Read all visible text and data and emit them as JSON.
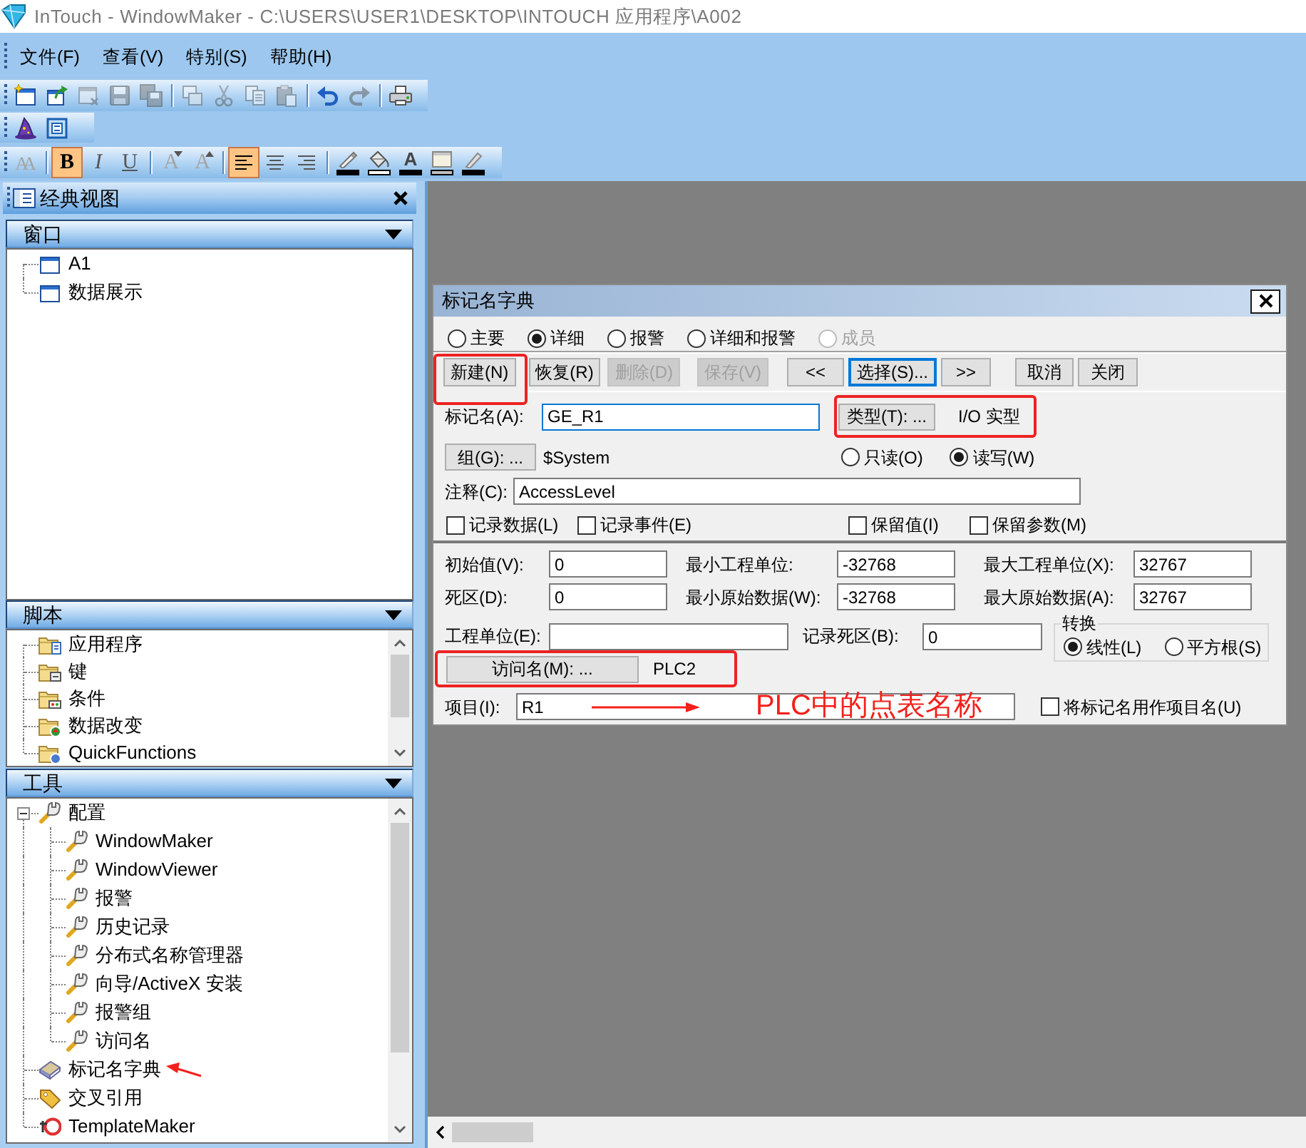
{
  "window": {
    "title": "InTouch - WindowMaker - C:\\USERS\\USER1\\DESKTOP\\INTOUCH 应用程序\\A002"
  },
  "menu": [
    {
      "label": "文件(F)"
    },
    {
      "label": "查看(V)"
    },
    {
      "label": "特别(S)"
    },
    {
      "label": "帮助(H)"
    }
  ],
  "toolbars": [
    [
      {
        "kind": "new",
        "disabled": false
      },
      {
        "kind": "open",
        "disabled": false
      },
      {
        "kind": "close",
        "disabled": true
      },
      {
        "kind": "save",
        "disabled": true
      },
      {
        "kind": "saveall",
        "disabled": true
      },
      {
        "kind": "separator"
      },
      {
        "kind": "duplicate",
        "disabled": true
      },
      {
        "kind": "cut",
        "disabled": true
      },
      {
        "kind": "copy",
        "disabled": true
      },
      {
        "kind": "paste",
        "disabled": true
      },
      {
        "kind": "separator"
      },
      {
        "kind": "undo",
        "disabled": false
      },
      {
        "kind": "redo",
        "disabled": true
      },
      {
        "kind": "separator"
      },
      {
        "kind": "print",
        "disabled": false
      }
    ],
    [
      {
        "kind": "wizard",
        "disabled": false
      },
      {
        "kind": "script",
        "disabled": false
      }
    ],
    [
      {
        "kind": "font",
        "glyph": "AA",
        "disabled": true
      },
      {
        "kind": "separator"
      },
      {
        "kind": "bold",
        "glyph": "B",
        "disabled": false,
        "selected": true
      },
      {
        "kind": "italic",
        "glyph": "I",
        "disabled": false,
        "selected": false
      },
      {
        "kind": "underline",
        "glyph": "U",
        "disabled": false,
        "selected": false
      },
      {
        "kind": "separator"
      },
      {
        "kind": "shrink",
        "glyph": "A",
        "disabled": true
      },
      {
        "kind": "enlarge",
        "glyph": "A",
        "disabled": true
      },
      {
        "kind": "separator"
      },
      {
        "kind": "alignleft",
        "disabled": false,
        "selected": true
      },
      {
        "kind": "aligncenter",
        "disabled": false,
        "selected": false
      },
      {
        "kind": "alignright",
        "disabled": false,
        "selected": false
      },
      {
        "kind": "separator"
      },
      {
        "kind": "linecolor",
        "disabled": false,
        "color": "#000000"
      },
      {
        "kind": "fillcolor",
        "disabled": false,
        "color": "#ffffff"
      },
      {
        "kind": "textcolor",
        "glyph": "A",
        "disabled": false,
        "color": "#000000"
      },
      {
        "kind": "windowcolor",
        "disabled": false,
        "color": "#c0c0c0"
      },
      {
        "kind": "pen",
        "disabled": false,
        "color": "#000000"
      }
    ]
  ],
  "panel": {
    "title": "经典视图",
    "sections": [
      {
        "title": "窗口",
        "scrollable": false,
        "items": [
          {
            "label": "A1",
            "kind": "window"
          },
          {
            "label": "数据展示",
            "kind": "window"
          }
        ]
      },
      {
        "title": "脚本",
        "scrollable": true,
        "items": [
          {
            "label": "应用程序",
            "kind": "app-script"
          },
          {
            "label": "键",
            "kind": "key-script"
          },
          {
            "label": "条件",
            "kind": "condition-script"
          },
          {
            "label": "数据改变",
            "kind": "data-script"
          },
          {
            "label": "QuickFunctions",
            "kind": "quick-script"
          }
        ]
      },
      {
        "title": "工具",
        "scrollable": true,
        "items": [
          {
            "label": "配置",
            "kind": "tool",
            "expanded": true,
            "marked": false,
            "children": [
              {
                "label": "WindowMaker",
                "kind": "tool"
              },
              {
                "label": "WindowViewer",
                "kind": "tool"
              },
              {
                "label": "报警",
                "kind": "tool"
              },
              {
                "label": "历史记录",
                "kind": "tool"
              },
              {
                "label": "分布式名称管理器",
                "kind": "tool"
              },
              {
                "label": "向导/ActiveX 安装",
                "kind": "tool"
              },
              {
                "label": "报警组",
                "kind": "tool"
              },
              {
                "label": "访问名",
                "kind": "tool"
              }
            ]
          },
          {
            "label": "标记名字典",
            "kind": "dictionary",
            "marked": true
          },
          {
            "label": "交叉引用",
            "kind": "crossref",
            "marked": false
          },
          {
            "label": "TemplateMaker",
            "kind": "template",
            "marked": false
          }
        ]
      }
    ]
  },
  "dialog": {
    "title": "标记名字典",
    "view_options": [
      {
        "label": "主要",
        "selected": false,
        "disabled": false
      },
      {
        "label": "详细",
        "selected": true,
        "disabled": false
      },
      {
        "label": "报警",
        "selected": false,
        "disabled": false
      },
      {
        "label": "详细和报警",
        "selected": false,
        "disabled": false
      },
      {
        "label": "成员",
        "selected": false,
        "disabled": true
      }
    ],
    "buttons": [
      {
        "label": "新建(N)",
        "disabled": false,
        "focused": false,
        "highlighted": true
      },
      {
        "label": "恢复(R)",
        "disabled": false,
        "focused": false,
        "highlighted": false
      },
      {
        "label": "删除(D)",
        "disabled": true,
        "focused": false,
        "highlighted": false
      },
      {
        "label": "保存(V)",
        "disabled": true,
        "focused": false,
        "highlighted": false
      },
      {
        "label": "<<",
        "disabled": false,
        "focused": false,
        "highlighted": false
      },
      {
        "label": "选择(S)...",
        "disabled": false,
        "focused": true,
        "highlighted": false
      },
      {
        "label": ">>",
        "disabled": false,
        "focused": false,
        "highlighted": false
      },
      {
        "label": "取消",
        "disabled": false,
        "focused": false,
        "highlighted": false
      },
      {
        "label": "关闭",
        "disabled": false,
        "focused": false,
        "highlighted": false
      }
    ],
    "tagname": {
      "label": "标记名(A):",
      "value": "GE_R1",
      "focused": true
    },
    "type": {
      "button": "类型(T): ...",
      "value": "I/O 实型",
      "highlighted": true
    },
    "group": {
      "button": "组(G): ...",
      "value": "$System"
    },
    "access_modes": [
      {
        "label": "只读(O)",
        "selected": false
      },
      {
        "label": "读写(W)",
        "selected": true
      }
    ],
    "comment": {
      "label": "注释(C):",
      "value": "AccessLevel"
    },
    "options": [
      {
        "label": "记录数据(L)",
        "checked": false
      },
      {
        "label": "记录事件(E)",
        "checked": false
      },
      {
        "label": "保留值(I)",
        "checked": false
      },
      {
        "label": "保留参数(M)",
        "checked": false
      }
    ],
    "fields": [
      {
        "label": "初始值(V):",
        "value": "0"
      },
      {
        "label": "最小工程单位:",
        "value": "-32768"
      },
      {
        "label": "最大工程单位(X):",
        "value": "32767"
      },
      {
        "label": "死区(D):",
        "value": "0"
      },
      {
        "label": "最小原始数据(W):",
        "value": "-32768"
      },
      {
        "label": "最大原始数据(A):",
        "value": "32767"
      }
    ],
    "eng_units": {
      "label": "工程单位(E):"
    },
    "log_deadband": {
      "label": "记录死区(B):",
      "value": "0"
    },
    "conversion": {
      "title": "转换",
      "options": [
        {
          "label": "线性(L)",
          "selected": true
        },
        {
          "label": "平方根(S)",
          "selected": false
        }
      ]
    },
    "access_name": {
      "button": "访问名(M): ...",
      "value": "PLC2",
      "highlighted": true
    },
    "item": {
      "label": "项目(I):",
      "value": "R1",
      "annotation": "PLC中的点表名称"
    },
    "use_tagname": {
      "label": "将标记名用作项目名(U)",
      "checked": false
    }
  }
}
